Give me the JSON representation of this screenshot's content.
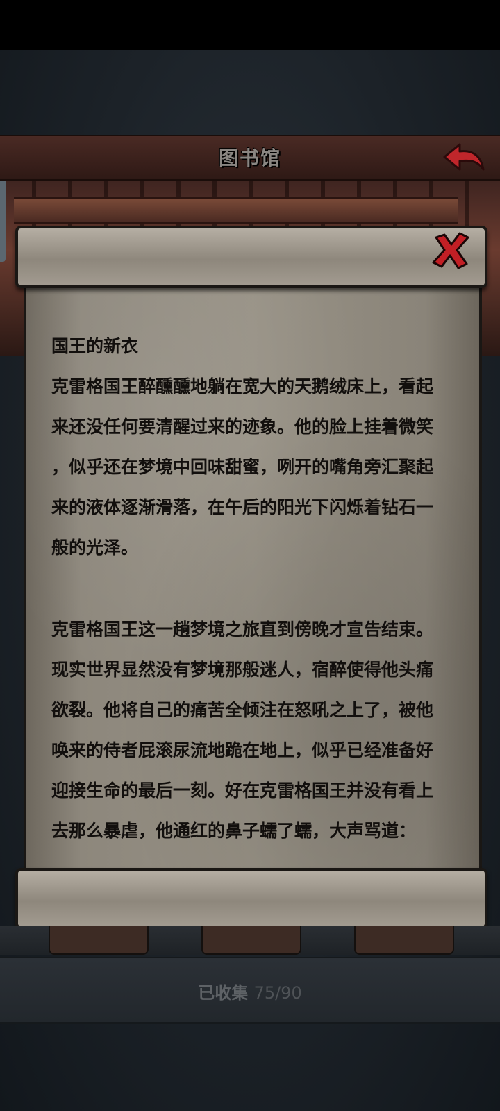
{
  "header": {
    "title": "图书馆",
    "back_icon": "back-arrow-icon",
    "accent": "#c0262b"
  },
  "dialog": {
    "close_icon": "close-x-icon",
    "heading": "国王的新衣",
    "paragraph1": "克雷格国王醉醺醺地躺在宽大的天鹅绒床上，看起\n来还没任何要清醒过来的迹象。他的脸上挂着微笑\n，似乎还在梦境中回味甜蜜，咧开的嘴角旁汇聚起\n来的液体逐渐滑落，在午后的阳光下闪烁着钻石一\n般的光泽。",
    "paragraph2": "克雷格国王这一趟梦境之旅直到傍晚才宣告结束。\n现实世界显然没有梦境那般迷人，宿醉使得他头痛\n欲裂。他将自己的痛苦全倾注在怒吼之上了，被他\n唤来的侍者屁滚尿流地跪在地上，似乎已经准备好\n迎接生命的最后一刻。好在克雷格国王并没有看上\n去那么暴虐，他通红的鼻子蠕了蠕，大声骂道："
  },
  "footer": {
    "collected_label": "已收集",
    "collected_count": "75/90"
  }
}
